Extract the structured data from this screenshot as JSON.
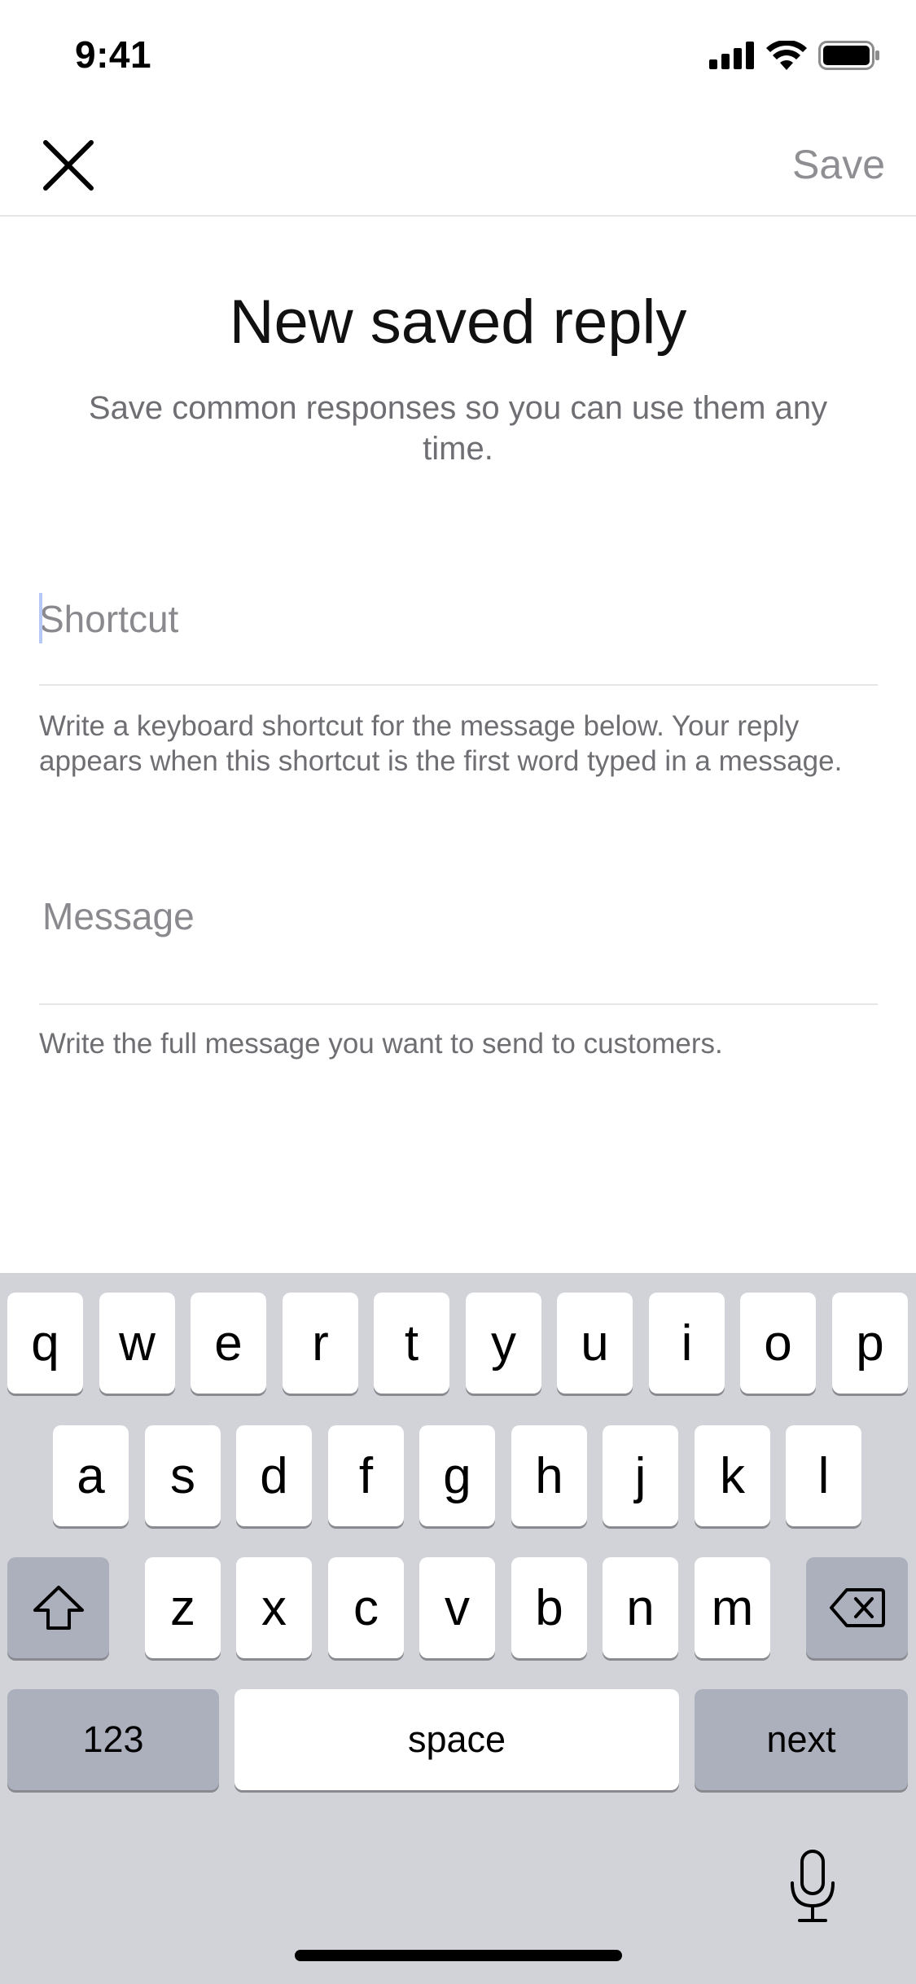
{
  "status_bar": {
    "time": "9:41",
    "icons": [
      "signal-icon",
      "wifi-icon",
      "battery-icon"
    ]
  },
  "nav": {
    "close_icon": "close-icon",
    "save_label": "Save"
  },
  "header": {
    "title": "New saved reply",
    "subtitle": "Save common responses so you can use them any time."
  },
  "form": {
    "shortcut": {
      "placeholder": "Shortcut",
      "value": "",
      "helper": "Write a keyboard shortcut for the message below. Your reply appears when this shortcut is the first word typed in a message."
    },
    "message": {
      "placeholder": "Message",
      "value": "",
      "helper": "Write the full message you want to send to customers."
    }
  },
  "keyboard": {
    "row1": [
      "q",
      "w",
      "e",
      "r",
      "t",
      "y",
      "u",
      "i",
      "o",
      "p"
    ],
    "row2": [
      "a",
      "s",
      "d",
      "f",
      "g",
      "h",
      "j",
      "k",
      "l"
    ],
    "row3": [
      "z",
      "x",
      "c",
      "v",
      "b",
      "n",
      "m"
    ],
    "numbers_label": "123",
    "space_label": "space",
    "next_label": "next",
    "shift_icon": "shift-icon",
    "delete_icon": "delete-icon",
    "mic_icon": "microphone-icon"
  },
  "colors": {
    "accent_caret": "#b6c8f5",
    "keyboard_bg": "#d1d3d9",
    "dark_key": "#abb0bc",
    "secondary_text": "#6e6e73"
  }
}
